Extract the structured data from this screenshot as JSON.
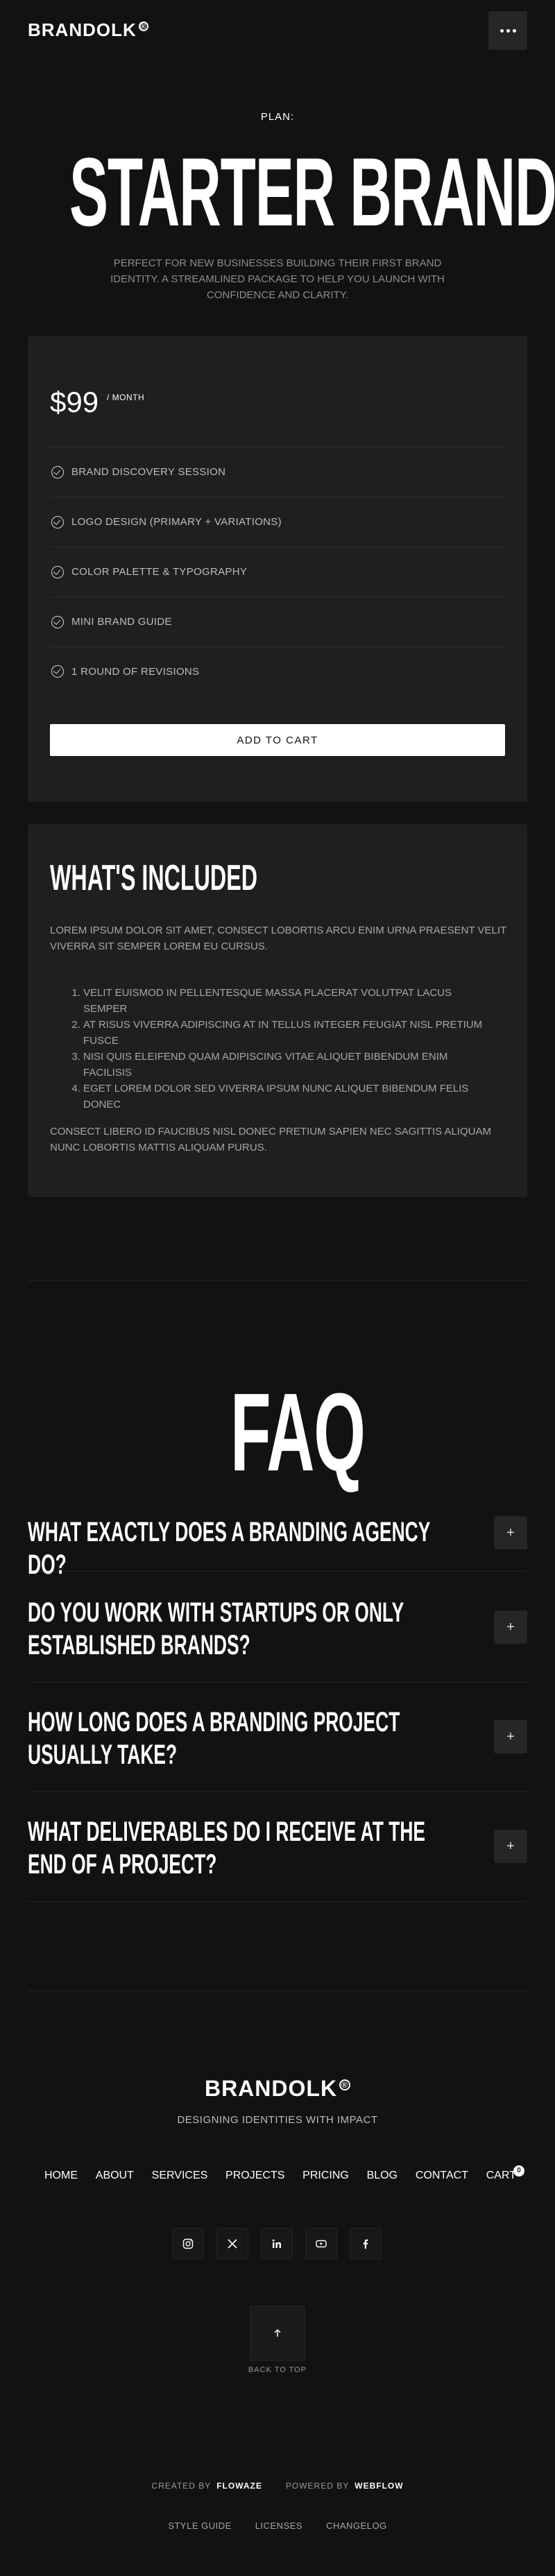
{
  "header": {
    "logo": "BRANDOLK",
    "logo_mark": "®",
    "menu_icon": "more-horizontal-icon"
  },
  "hero": {
    "plan_label": "PLAN:",
    "title": "STARTER BRAND",
    "description": "PERFECT FOR NEW BUSINESSES BUILDING THEIR FIRST BRAND IDENTITY. A STREAMLINED PACKAGE TO HELP YOU LAUNCH WITH CONFIDENCE AND CLARITY."
  },
  "pricing": {
    "price": "$99",
    "period": "/ MONTH",
    "features": [
      "BRAND DISCOVERY SESSION",
      "LOGO DESIGN (PRIMARY + VARIATIONS)",
      "COLOR PALETTE & TYPOGRAPHY",
      "MINI BRAND GUIDE",
      "1 ROUND OF REVISIONS"
    ],
    "cta": "ADD TO CART"
  },
  "included": {
    "title": "WHAT'S INCLUDED",
    "intro": "LOREM IPSUM DOLOR SIT AMET, CONSECT LOBORTIS ARCU ENIM URNA PRAESENT VELIT VIVERRA SIT SEMPER LOREM EU CURSUS.",
    "items": [
      "VELIT EUISMOD IN PELLENTESQUE MASSA PLACERAT VOLUTPAT LACUS SEMPER",
      "AT RISUS VIVERRA ADIPISCING AT IN TELLUS INTEGER FEUGIAT NISL PRETIUM FUSCE",
      "NISI QUIS ELEIFEND QUAM ADIPISCING VITAE ALIQUET BIBENDUM ENIM FACILISIS",
      "EGET LOREM DOLOR SED VIVERRA IPSUM NUNC ALIQUET BIBENDUM FELIS DONEC"
    ],
    "outro": "CONSECT LIBERO ID FAUCIBUS NISL DONEC PRETIUM SAPIEN NEC SAGITTIS ALIQUAM NUNC LOBORTIS MATTIS ALIQUAM PURUS."
  },
  "faq": {
    "title": "FAQ",
    "questions": [
      "WHAT EXACTLY DOES A BRANDING AGENCY DO?",
      "DO YOU WORK WITH STARTUPS OR ONLY ESTABLISHED BRANDS?",
      "HOW LONG DOES A BRANDING PROJECT USUALLY TAKE?",
      "WHAT DELIVERABLES DO I RECEIVE AT THE END OF A PROJECT?"
    ],
    "expand_symbol": "+"
  },
  "footer": {
    "logo": "BRANDOLK",
    "logo_mark": "®",
    "tagline": "DESIGNING IDENTITIES WITH IMPACT",
    "nav": [
      "HOME",
      "ABOUT",
      "SERVICES",
      "PROJECTS",
      "PRICING",
      "BLOG",
      "CONTACT",
      "CART"
    ],
    "cart_count": "0",
    "socials": [
      "instagram-icon",
      "x-icon",
      "linkedin-icon",
      "youtube-icon",
      "facebook-icon"
    ],
    "back_to_top": "BACK TO TOP",
    "created_by_label": "CREATED BY",
    "created_by": "FLOWAZE",
    "powered_by_label": "POWERED BY",
    "powered_by": "WEBFLOW",
    "legal": [
      "STYLE GUIDE",
      "LICENSES",
      "CHANGELOG"
    ]
  },
  "colors": {
    "background": "#121212",
    "card": "#1f1f1f",
    "text": "#ffffff",
    "muted": "#a6a6a6"
  }
}
